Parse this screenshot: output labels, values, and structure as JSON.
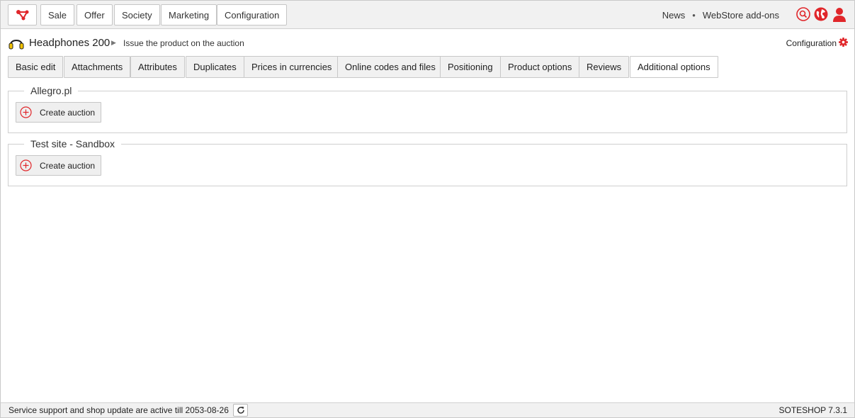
{
  "colors": {
    "accent": "#e0262a",
    "bar_bg": "#f1f1f1",
    "border": "#c8c8c8"
  },
  "topbar": {
    "logo_icon": "soteshop-logo-icon",
    "nav": [
      "Sale",
      "Offer",
      "Society",
      "Marketing",
      "Configuration"
    ],
    "links": {
      "news": "News",
      "separator": "•",
      "addons": "WebStore add-ons"
    },
    "icons": [
      "search-icon",
      "globe-icon",
      "user-icon"
    ]
  },
  "breadcrumb": {
    "icon": "headphones-icon",
    "title": "Headphones 200",
    "arrow": "▶",
    "subtitle": "Issue the product on the auction",
    "config_label": "Configuration",
    "config_icon": "gear-icon"
  },
  "tabs": [
    {
      "label": "Basic edit",
      "active": false
    },
    {
      "label": "Attachments",
      "active": false
    },
    {
      "label": "Attributes",
      "active": false
    },
    {
      "label": "Duplicates",
      "active": false
    },
    {
      "label": "Prices in currencies",
      "active": false
    },
    {
      "label": "Online codes and files",
      "active": false
    },
    {
      "label": "Positioning",
      "active": false
    },
    {
      "label": "Product options",
      "active": false
    },
    {
      "label": "Reviews",
      "active": false
    },
    {
      "label": "Additional options",
      "active": true
    }
  ],
  "groups": [
    {
      "legend": "Allegro.pl",
      "button": "Create auction",
      "button_icon": "plus-circle-icon"
    },
    {
      "legend": "Test site - Sandbox",
      "button": "Create auction",
      "button_icon": "plus-circle-icon"
    }
  ],
  "footer": {
    "status": "Service support and shop update are active till 2053-08-26",
    "refresh_icon": "refresh-icon",
    "version": "SOTESHOP 7.3.1"
  }
}
